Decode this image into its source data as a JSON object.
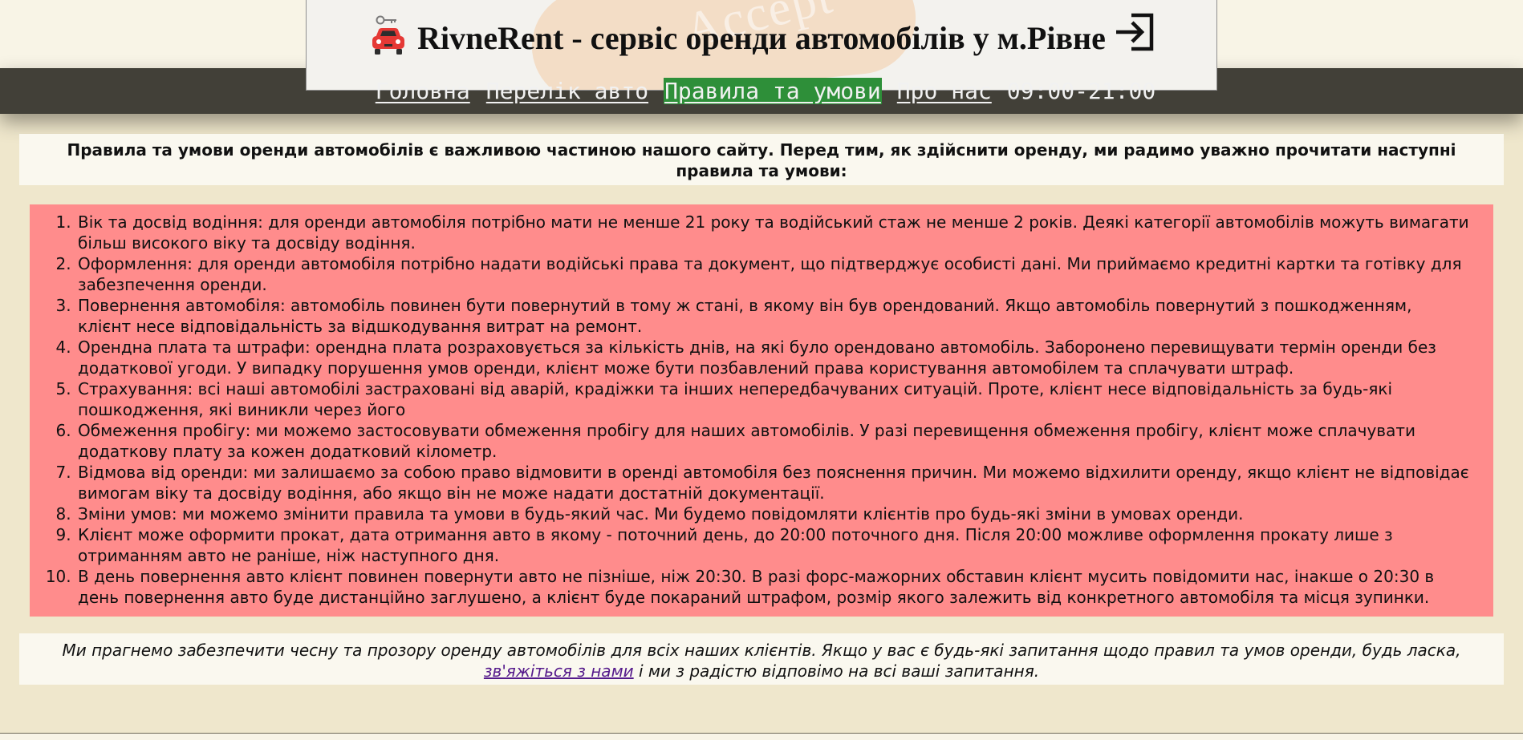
{
  "header": {
    "title": "RivneRent - сервіс оренди автомобілів у м.Рівне",
    "logo_icon": "car-key-icon",
    "login_icon": "login-icon",
    "deco_text": "Accept"
  },
  "nav": {
    "items": [
      {
        "label": "Головна",
        "active": false
      },
      {
        "label": "Перелік авто",
        "active": false
      },
      {
        "label": "Правила та умови",
        "active": true
      },
      {
        "label": "Про нас",
        "active": false
      }
    ],
    "hours": "09:00-21:00",
    "active_color": "#2e8f39"
  },
  "intro": "Правила та умови оренди автомобілів є важливою частиною нашого сайту. Перед тим, як здійснити оренду, ми радимо уважно прочитати наступні правила та умови:",
  "rules": [
    "Вік та досвід водіння: для оренди автомобіля потрібно мати не менше 21 року та водійський стаж не менше 2 років. Деякі категорії автомобілів можуть вимагати більш високого віку та досвіду водіння.",
    "Оформлення: для оренди автомобіля потрібно надати водійські права та документ, що підтверджує особисті дані. Ми приймаємо кредитні картки та готівку для забезпечення оренди.",
    "Повернення автомобіля: автомобіль повинен бути повернутий в тому ж стані, в якому він був орендований. Якщо автомобіль повернутий з пошкодженням, клієнт несе відповідальність за відшкодування витрат на ремонт.",
    "Орендна плата та штрафи: орендна плата розраховується за кількість днів, на які було орендовано автомобіль. Заборонено перевищувати термін оренди без додаткової угоди. У випадку порушення умов оренди, клієнт може бути позбавлений права користування автомобілем та сплачувати штраф.",
    "Страхування: всі наші автомобілі застраховані від аварій, крадіжки та інших непередбачуваних ситуацій. Проте, клієнт несе відповідальність за будь-які пошкодження, які виникли через його",
    "Обмеження пробігу: ми можемо застосовувати обмеження пробігу для наших автомобілів. У разі перевищення обмеження пробігу, клієнт може сплачувати додаткову плату за кожен додатковий кілометр.",
    "Відмова від оренди: ми залишаємо за собою право відмовити в оренді автомобіля без пояснення причин. Ми можемо відхилити оренду, якщо клієнт не відповідає вимогам віку та досвіду водіння, або якщо він не може надати достатній документації.",
    "Зміни умов: ми можемо змінити правила та умови в будь-який час. Ми будемо повідомляти клієнтів про будь-які зміни в умовах оренди.",
    "Клієнт може оформити прокат, дата отримання авто в якому - поточний день, до 20:00 поточного дня. Після 20:00 можливе оформлення прокату лише з отриманням авто не раніше, ніж наступного дня.",
    "В день повернення авто клієнт повинен повернути авто не пізніше, ніж 20:30. В разі форс-мажорних обставин клієнт мусить повідомити нас, інакше о 20:30 в день повернення авто буде дистанційно заглушено, а клієнт буде покараний штрафом, розмір якого залежить від конкретного автомобіля та місця зупинки."
  ],
  "outro": {
    "before": "Ми прагнемо забезпечити чесну та прозору оренду автомобілів для всіх наших клієнтів. Якщо у вас є будь-які запитання щодо правил та умов оренди, будь ласка, ",
    "link": "зв'яжіться з нами",
    "after": " і ми з радістю відповімо на всі ваші запитання."
  },
  "colors": {
    "page_bg": "#efe7cc",
    "navbar_bg": "#424038",
    "rules_bg": "#ff8c8c",
    "panel_bg": "#faf8ef",
    "link": "#551a8b"
  }
}
